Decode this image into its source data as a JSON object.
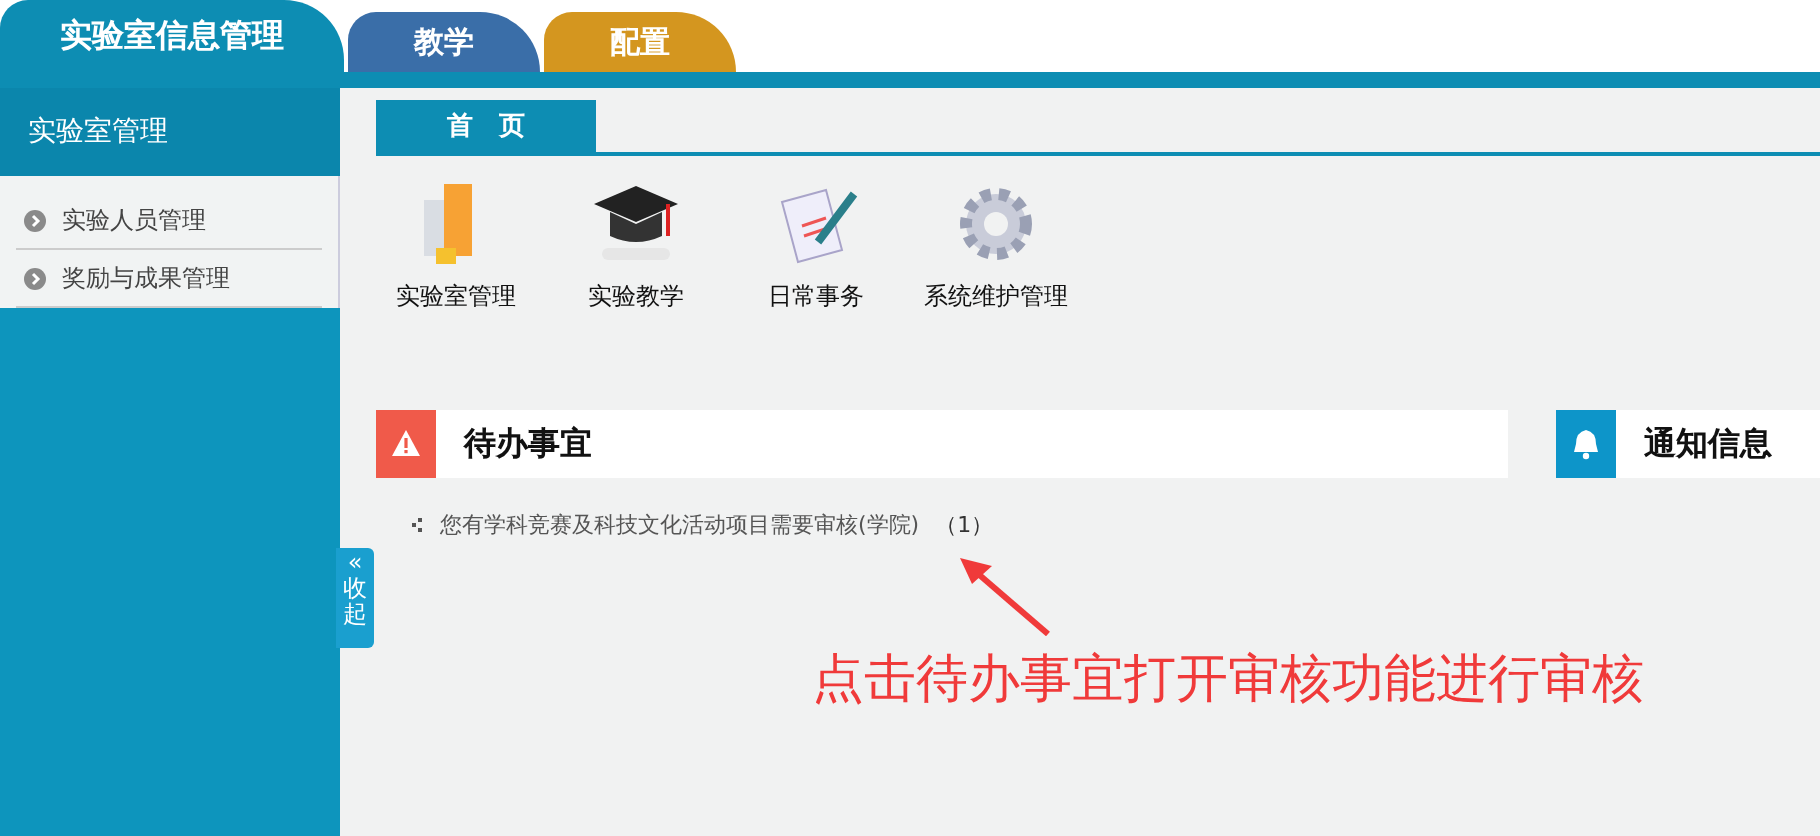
{
  "top_tabs": [
    {
      "label": "实验室信息管理",
      "kind": "main",
      "selected": true
    },
    {
      "label": "教学",
      "kind": "blue",
      "selected": false
    },
    {
      "label": "配置",
      "kind": "gold",
      "selected": false
    }
  ],
  "sidebar": {
    "title": "实验室管理",
    "items": [
      {
        "label": "实验人员管理"
      },
      {
        "label": "奖励与成果管理"
      }
    ],
    "collapse": {
      "arrow": "«",
      "label": "收起"
    }
  },
  "page_tabs": [
    {
      "label": "首　页",
      "selected": true
    }
  ],
  "shortcuts": [
    {
      "label": "实验室管理",
      "kind": "building"
    },
    {
      "label": "实验教学",
      "kind": "cap"
    },
    {
      "label": "日常事务",
      "kind": "notepad"
    },
    {
      "label": "系统维护管理",
      "kind": "gear"
    }
  ],
  "todo": {
    "title": "待办事宜",
    "items": [
      {
        "text": "您有学科竞赛及科技文化活动项目需要审核(学院)",
        "count": "（1）"
      }
    ]
  },
  "notice": {
    "title": "通知信息"
  },
  "annotation": "点击待办事宜打开审核功能进行审核"
}
